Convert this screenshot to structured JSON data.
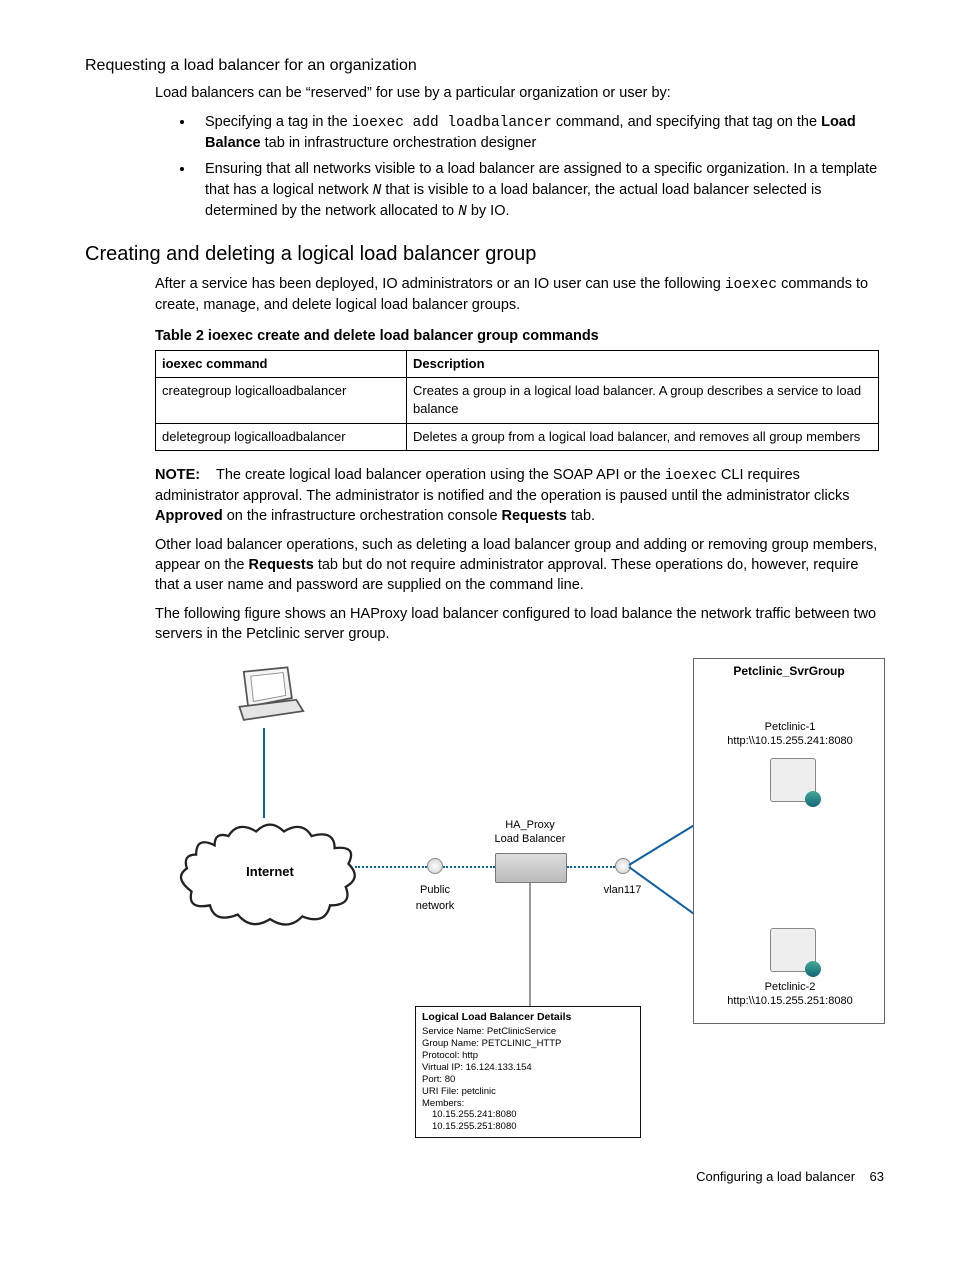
{
  "h_request": "Requesting a load balancer for an organization",
  "p_intro": "Load balancers can be “reserved” for use by a particular organization or user by:",
  "bullet1_a": "Specifying a tag in the ",
  "bullet1_code": "ioexec add loadbalancer",
  "bullet1_b": " command, and specifying that tag on the ",
  "bullet1_bold": "Load Balance",
  "bullet1_c": " tab in infrastructure orchestration designer",
  "bullet2_a": "Ensuring that all networks visible to a load balancer are assigned to a specific organization. In a template that has a logical network ",
  "bullet2_n1": "N",
  "bullet2_b": " that is visible to a load balancer, the actual load balancer selected is determined by the network allocated to ",
  "bullet2_n2": "N",
  "bullet2_c": " by IO.",
  "h_create": "Creating and deleting a logical load balancer group",
  "p_after_a": "After a service has been deployed, IO administrators or an IO user can use the following ",
  "p_after_code": "ioexec",
  "p_after_b": " commands to create, manage, and delete logical load balancer groups.",
  "table_caption": "Table 2 ioexec create and delete load balancer group commands",
  "th1": "ioexec command",
  "th2": "Description",
  "r1c1": "creategroup logicalloadbalancer",
  "r1c2": "Creates a group in a logical load balancer. A group describes a service to load balance",
  "r2c1": "deletegroup logicalloadbalancer",
  "r2c2": "Deletes a group from a logical load balancer, and removes all group members",
  "note_label": "NOTE:",
  "note_a": " The create logical load balancer operation using the SOAP API or the ",
  "note_code": "ioexec",
  "note_b": " CLI requires administrator approval. The administrator is notified and the operation is paused until the administrator clicks ",
  "note_bold1": "Approved",
  "note_c": " on the infrastructure orchestration console ",
  "note_bold2": "Requests",
  "note_d": " tab.",
  "p_other_a": "Other load balancer operations, such as deleting a load balancer group and adding or removing group members, appear on the ",
  "p_other_bold": "Requests",
  "p_other_b": " tab but do not require administrator approval. These operations do, however, require that a user name and password are supplied on the command line.",
  "p_fig": "The following figure shows an HAProxy load balancer configured to load balance the network traffic between two servers in the Petclinic server group.",
  "diagram": {
    "internet": "Internet",
    "public_net": "Public\nnetwork",
    "proxy_l1": "HA_Proxy",
    "proxy_l2": "Load Balancer",
    "vlan": "vlan117",
    "grp": "Petclinic_SvrGroup",
    "s1_name": "Petclinic-1",
    "s1_url": "http:\\\\10.15.255.241:8080",
    "s2_name": "Petclinic-2",
    "s2_url": "http:\\\\10.15.255.251:8080",
    "det_title": "Logical Load Balancer Details",
    "det_l1": "Service Name: PetClinicService",
    "det_l2": "Group Name: PETCLINIC_HTTP",
    "det_l3": "Protocol: http",
    "det_l4": "Virtual IP: 16.124.133.154",
    "det_l5": "Port: 80",
    "det_l6": "URI File: petclinic",
    "det_l7": "Members:",
    "det_l8": "10.15.255.241:8080",
    "det_l9": "10.15.255.251:8080"
  },
  "footer_text": "Configuring a load balancer",
  "footer_page": "63"
}
